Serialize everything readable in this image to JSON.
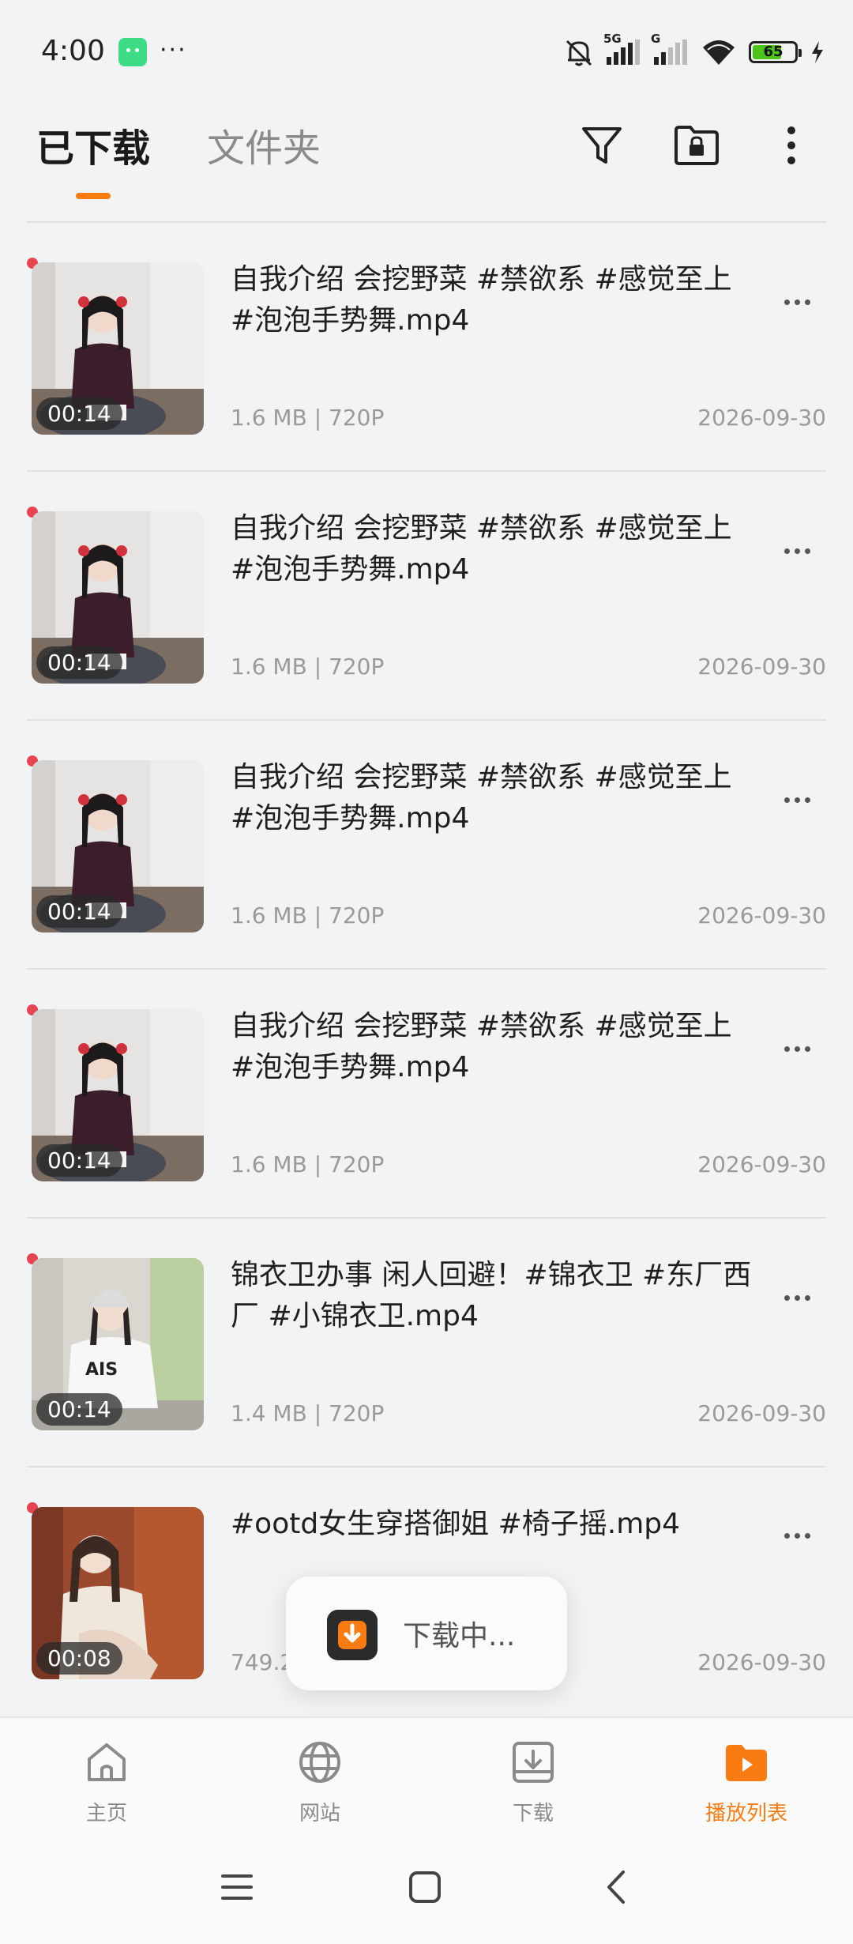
{
  "status_bar": {
    "time": "4:00",
    "more": "···",
    "signal1_label": "5G",
    "signal2_label": "G",
    "battery": "65"
  },
  "header": {
    "tab_downloaded": "已下载",
    "tab_folder": "文件夹"
  },
  "items": [
    {
      "title": "自我介绍 会挖野菜 #禁欲系 #感觉至上 #泡泡手势舞.mp4",
      "duration": "00:14",
      "meta": "1.6 MB | 720P",
      "date": "2026-09-30"
    },
    {
      "title": "自我介绍 会挖野菜 #禁欲系 #感觉至上 #泡泡手势舞.mp4",
      "duration": "00:14",
      "meta": "1.6 MB | 720P",
      "date": "2026-09-30"
    },
    {
      "title": "自我介绍 会挖野菜 #禁欲系 #感觉至上 #泡泡手势舞.mp4",
      "duration": "00:14",
      "meta": "1.6 MB | 720P",
      "date": "2026-09-30"
    },
    {
      "title": "自我介绍 会挖野菜 #禁欲系 #感觉至上 #泡泡手势舞.mp4",
      "duration": "00:14",
      "meta": "1.6 MB | 720P",
      "date": "2026-09-30"
    },
    {
      "title": "锦衣卫办事 闲人回避！#锦衣卫 #东厂西厂 #小锦衣卫.mp4",
      "duration": "00:14",
      "meta": "1.4 MB | 720P",
      "date": "2026-09-30"
    },
    {
      "title": "#ootd女生穿搭御姐 #椅子摇.mp4",
      "duration": "00:08",
      "meta": "749.2",
      "date": "2026-09-30"
    }
  ],
  "toast": {
    "text": "下载中..."
  },
  "bottom_nav": {
    "home": "主页",
    "sites": "网站",
    "downloads": "下载",
    "playlist": "播放列表"
  },
  "colors": {
    "accent": "#fa7b12",
    "unread_dot": "#e84350"
  }
}
